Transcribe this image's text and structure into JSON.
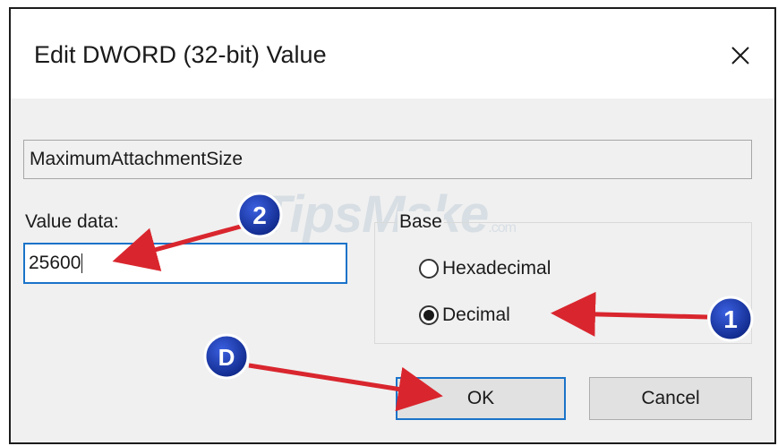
{
  "dialog": {
    "title": "Edit DWORD (32-bit) Value",
    "value_name": "MaximumAttachmentSize",
    "value_data_label": "Value data:",
    "value_data": "25600",
    "base_label": "Base",
    "radio_hexadecimal": "Hexadecimal",
    "radio_decimal": "Decimal",
    "selected_base": "Decimal",
    "ok_label": "OK",
    "cancel_label": "Cancel"
  },
  "annotations": {
    "step_1": "1",
    "step_2": "2",
    "step_d": "D",
    "watermark": "TipsMake",
    "watermark_suffix": ".com",
    "arrow_color": "#d9262e",
    "badge_color": "#1a3aa8"
  },
  "icons": {
    "close": "close-icon"
  }
}
